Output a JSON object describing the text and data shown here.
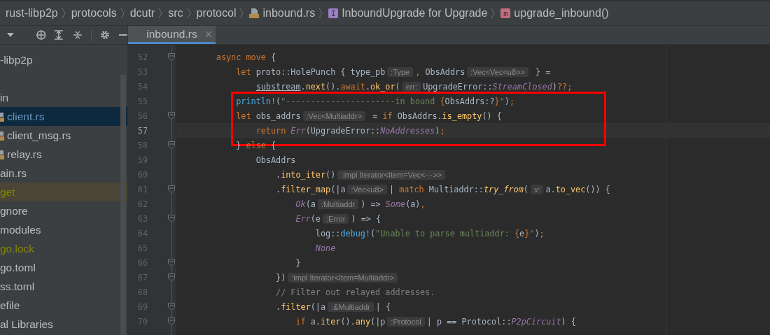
{
  "breadcrumbs": [
    {
      "label": "rust-libp2p",
      "kind": "folder"
    },
    {
      "label": "protocols",
      "kind": "folder"
    },
    {
      "label": "dcutr",
      "kind": "folder"
    },
    {
      "label": "src",
      "kind": "folder"
    },
    {
      "label": "protocol",
      "kind": "folder"
    },
    {
      "label": "inbound.rs",
      "kind": "rs_file"
    },
    {
      "label": "InboundUpgrade for Upgrade",
      "kind": "impl",
      "badge": "I"
    },
    {
      "label": "upgrade_inbound()",
      "kind": "method",
      "badge": "m"
    }
  ],
  "project_tree": {
    "items": [
      {
        "label": "-libp2p",
        "selected": false,
        "modified": false,
        "ignored": false,
        "excluded": false,
        "file_icon": false
      },
      {
        "label": "in",
        "selected": false,
        "modified": false,
        "ignored": false,
        "excluded": false,
        "file_icon": false
      },
      {
        "label": "client.rs",
        "selected": true,
        "modified": true,
        "ignored": false,
        "excluded": false,
        "file_icon": true
      },
      {
        "label": "client_msg.rs",
        "selected": false,
        "modified": false,
        "ignored": false,
        "excluded": false,
        "file_icon": true
      },
      {
        "label": "relay.rs",
        "selected": false,
        "modified": false,
        "ignored": false,
        "excluded": false,
        "file_icon": true
      },
      {
        "label": "ain.rs",
        "selected": false,
        "modified": false,
        "ignored": false,
        "excluded": false,
        "file_icon": false
      },
      {
        "label": "get",
        "selected": false,
        "modified": false,
        "ignored": false,
        "excluded": true,
        "file_icon": false
      },
      {
        "label": "gnore",
        "selected": false,
        "modified": false,
        "ignored": false,
        "excluded": false,
        "file_icon": false
      },
      {
        "label": "modules",
        "selected": false,
        "modified": false,
        "ignored": false,
        "excluded": false,
        "file_icon": false
      },
      {
        "label": "go.lock",
        "selected": false,
        "modified": false,
        "ignored": true,
        "excluded": false,
        "file_icon": false
      },
      {
        "label": "go.toml",
        "selected": false,
        "modified": false,
        "ignored": false,
        "excluded": false,
        "file_icon": false
      },
      {
        "label": "ss.toml",
        "selected": false,
        "modified": false,
        "ignored": false,
        "excluded": false,
        "file_icon": false
      },
      {
        "label": "efile",
        "selected": false,
        "modified": false,
        "ignored": false,
        "excluded": false,
        "file_icon": false
      },
      {
        "label": "al Libraries",
        "selected": false,
        "modified": false,
        "ignored": false,
        "excluded": false,
        "file_icon": false
      }
    ]
  },
  "tabs": [
    {
      "label": "inbound.rs",
      "selected": true,
      "closable": true
    }
  ],
  "editor": {
    "lines": [
      {
        "number": "52",
        "fold": true,
        "current": false,
        "boxed": false,
        "tokens": [
          {
            "kind": "kw",
            "text": "async move "
          },
          {
            "kind": "plain",
            "text": "{"
          }
        ],
        "children": [
          {
            "number": "53",
            "fold": false,
            "current": false,
            "boxed": false,
            "tokens": [
              {
                "kind": "kw",
                "text": "let "
              },
              {
                "kind": "plain",
                "text": "proto::HolePunch { type_pb"
              },
              {
                "kind": "hint",
                "text": ":Type"
              },
              {
                "kind": "kw",
                "text": ","
              },
              {
                "kind": "plain",
                "text": " ObsAddrs"
              },
              {
                "kind": "hint",
                "text": ":Vec<Vec<u8>>"
              },
              {
                "kind": "plain",
                "text": " } ="
              }
            ],
            "children": [
              {
                "number": "54",
                "fold": false,
                "current": false,
                "boxed": false,
                "tokens": [
                  {
                    "kind": "mut",
                    "text": "substream"
                  },
                  {
                    "kind": "plain",
                    "text": "."
                  },
                  {
                    "kind": "fn",
                    "text": "next"
                  },
                  {
                    "kind": "plain",
                    "text": "()."
                  },
                  {
                    "kind": "kw",
                    "text": "await"
                  },
                  {
                    "kind": "plain",
                    "text": "."
                  },
                  {
                    "kind": "fn",
                    "text": "ok_or"
                  },
                  {
                    "kind": "plain",
                    "text": "("
                  },
                  {
                    "kind": "hint",
                    "text": "err:"
                  },
                  {
                    "kind": "plain",
                    "text": "UpgradeError::"
                  },
                  {
                    "kind": "variant",
                    "text": "StreamClosed"
                  },
                  {
                    "kind": "plain",
                    "text": ")"
                  },
                  {
                    "kind": "kw",
                    "text": "??;"
                  }
                ]
              }
            ]
          },
          {
            "number": "55",
            "fold": false,
            "current": false,
            "boxed": true,
            "tokens": [
              {
                "kind": "macro",
                "text": "println!"
              },
              {
                "kind": "plain",
                "text": "("
              },
              {
                "kind": "str",
                "text": "\"----------------------in bound "
              },
              {
                "kind": "fmt",
                "text": "{"
              },
              {
                "kind": "plain",
                "text": "ObsAddrs:?"
              },
              {
                "kind": "fmt",
                "text": "}"
              },
              {
                "kind": "str",
                "text": "\""
              },
              {
                "kind": "plain",
                "text": ")"
              },
              {
                "kind": "kw",
                "text": ";"
              }
            ]
          },
          {
            "number": "56",
            "fold": true,
            "current": false,
            "boxed": true,
            "tokens": [
              {
                "kind": "kw",
                "text": "let "
              },
              {
                "kind": "plain",
                "text": "obs_addrs"
              },
              {
                "kind": "hint",
                "text": ":Vec<Multiaddr>"
              },
              {
                "kind": "plain",
                "text": " = "
              },
              {
                "kind": "kw",
                "text": "if "
              },
              {
                "kind": "plain",
                "text": "ObsAddrs."
              },
              {
                "kind": "fn",
                "text": "is_empty"
              },
              {
                "kind": "plain",
                "text": "() {"
              }
            ],
            "children": [
              {
                "number": "57",
                "fold": false,
                "current": true,
                "boxed": true,
                "tokens": [
                  {
                    "kind": "kw",
                    "text": "return "
                  },
                  {
                    "kind": "variant",
                    "text": "Err"
                  },
                  {
                    "kind": "plain",
                    "text": "(UpgradeError::"
                  },
                  {
                    "kind": "variant",
                    "text": "NoAddresses"
                  },
                  {
                    "kind": "plain",
                    "text": ")"
                  },
                  {
                    "kind": "kw",
                    "text": ";"
                  }
                ]
              }
            ]
          },
          {
            "number": "58",
            "fold": true,
            "current": false,
            "boxed": false,
            "tokens": [
              {
                "kind": "plain",
                "text": "} "
              },
              {
                "kind": "kw",
                "text": "else "
              },
              {
                "kind": "plain",
                "text": "{"
              }
            ],
            "children": [
              {
                "number": "59",
                "fold": false,
                "current": false,
                "boxed": false,
                "tokens": [
                  {
                    "kind": "plain",
                    "text": "ObsAddrs"
                  }
                ],
                "children": [
                  {
                    "number": "60",
                    "fold": false,
                    "current": false,
                    "boxed": false,
                    "tokens": [
                      {
                        "kind": "plain",
                        "text": "."
                      },
                      {
                        "kind": "fn",
                        "text": "into_iter"
                      },
                      {
                        "kind": "plain",
                        "text": "()"
                      },
                      {
                        "kind": "hint",
                        "text": ":impl Iterator<Item=Vec<···>>"
                      }
                    ]
                  },
                  {
                    "number": "61",
                    "fold": true,
                    "current": false,
                    "boxed": false,
                    "tokens": [
                      {
                        "kind": "plain",
                        "text": "."
                      },
                      {
                        "kind": "fn",
                        "text": "filter_map"
                      },
                      {
                        "kind": "plain",
                        "text": "(|a"
                      },
                      {
                        "kind": "hint",
                        "text": ":Vec<u8>"
                      },
                      {
                        "kind": "plain",
                        "text": "| "
                      },
                      {
                        "kind": "kw",
                        "text": "match "
                      },
                      {
                        "kind": "plain",
                        "text": "Multiaddr::"
                      },
                      {
                        "kind": "fn_italic",
                        "text": "try_from"
                      },
                      {
                        "kind": "plain",
                        "text": "("
                      },
                      {
                        "kind": "hint",
                        "text": "v:"
                      },
                      {
                        "kind": "plain",
                        "text": "a."
                      },
                      {
                        "kind": "fn",
                        "text": "to_vec"
                      },
                      {
                        "kind": "plain",
                        "text": "()) {"
                      }
                    ],
                    "children": [
                      {
                        "number": "62",
                        "fold": false,
                        "current": false,
                        "boxed": false,
                        "tokens": [
                          {
                            "kind": "variant",
                            "text": "Ok"
                          },
                          {
                            "kind": "plain",
                            "text": "(a"
                          },
                          {
                            "kind": "hint",
                            "text": ":Multiaddr"
                          },
                          {
                            "kind": "plain",
                            "text": ") => "
                          },
                          {
                            "kind": "variant",
                            "text": "Some"
                          },
                          {
                            "kind": "plain",
                            "text": "(a)"
                          },
                          {
                            "kind": "kw",
                            "text": ","
                          }
                        ]
                      },
                      {
                        "number": "63",
                        "fold": true,
                        "current": false,
                        "boxed": false,
                        "tokens": [
                          {
                            "kind": "variant",
                            "text": "Err"
                          },
                          {
                            "kind": "plain",
                            "text": "(e"
                          },
                          {
                            "kind": "hint",
                            "text": ":Error"
                          },
                          {
                            "kind": "plain",
                            "text": ") => {"
                          }
                        ],
                        "children": [
                          {
                            "number": "64",
                            "fold": false,
                            "current": false,
                            "boxed": false,
                            "tokens": [
                              {
                                "kind": "plain",
                                "text": "log::"
                              },
                              {
                                "kind": "macro",
                                "text": "debug!"
                              },
                              {
                                "kind": "plain",
                                "text": "("
                              },
                              {
                                "kind": "str",
                                "text": "\"Unable to parse multiaddr: "
                              },
                              {
                                "kind": "fmt",
                                "text": "{"
                              },
                              {
                                "kind": "plain",
                                "text": "e"
                              },
                              {
                                "kind": "fmt",
                                "text": "}"
                              },
                              {
                                "kind": "str",
                                "text": "\""
                              },
                              {
                                "kind": "plain",
                                "text": ")"
                              },
                              {
                                "kind": "kw",
                                "text": ";"
                              }
                            ]
                          },
                          {
                            "number": "65",
                            "fold": false,
                            "current": false,
                            "boxed": false,
                            "tokens": [
                              {
                                "kind": "variant",
                                "text": "None"
                              }
                            ]
                          }
                        ]
                      },
                      {
                        "number": "66",
                        "fold": true,
                        "current": false,
                        "boxed": false,
                        "tokens": [
                          {
                            "kind": "plain",
                            "text": "}"
                          }
                        ]
                      }
                    ]
                  },
                  {
                    "number": "67",
                    "fold": true,
                    "current": false,
                    "boxed": false,
                    "tokens": [
                      {
                        "kind": "plain",
                        "text": "})"
                      },
                      {
                        "kind": "hint",
                        "text": ":impl Iterator<Item=Multiaddr>"
                      }
                    ]
                  },
                  {
                    "number": "68",
                    "fold": false,
                    "current": false,
                    "boxed": false,
                    "tokens": [
                      {
                        "kind": "comment",
                        "text": "// Filter out relayed addresses."
                      }
                    ]
                  },
                  {
                    "number": "69",
                    "fold": true,
                    "current": false,
                    "boxed": false,
                    "tokens": [
                      {
                        "kind": "plain",
                        "text": "."
                      },
                      {
                        "kind": "fn",
                        "text": "filter"
                      },
                      {
                        "kind": "plain",
                        "text": "(|a"
                      },
                      {
                        "kind": "hint",
                        "text": ":&Multiaddr"
                      },
                      {
                        "kind": "plain",
                        "text": "| {"
                      }
                    ],
                    "children": [
                      {
                        "number": "70",
                        "fold": true,
                        "current": false,
                        "boxed": false,
                        "tokens": [
                          {
                            "kind": "kw",
                            "text": "if "
                          },
                          {
                            "kind": "plain",
                            "text": "a."
                          },
                          {
                            "kind": "fn",
                            "text": "iter"
                          },
                          {
                            "kind": "plain",
                            "text": "()."
                          },
                          {
                            "kind": "fn",
                            "text": "any"
                          },
                          {
                            "kind": "plain",
                            "text": "(|p"
                          },
                          {
                            "kind": "hint",
                            "text": ":Protocol"
                          },
                          {
                            "kind": "plain",
                            "text": "| p == Protocol::"
                          },
                          {
                            "kind": "variant",
                            "text": "P2pCircuit"
                          },
                          {
                            "kind": "plain",
                            "text": ") {"
                          }
                        ]
                      }
                    ]
                  }
                ]
              }
            ]
          }
        ]
      }
    ]
  }
}
